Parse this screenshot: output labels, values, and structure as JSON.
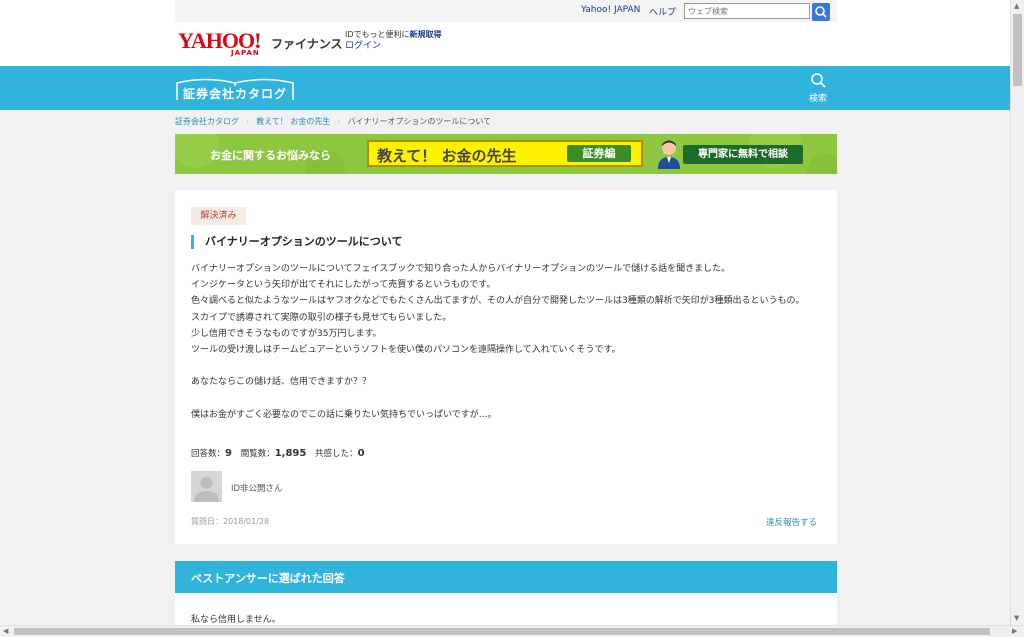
{
  "header": {
    "yahoo_japan_link": "Yahoo! JAPAN",
    "help_link": "ヘルプ",
    "search_placeholder": "ウェブ検索",
    "logo_text": "YAHOO!",
    "logo_sub": "JAPAN",
    "logo_service": "ファイナンス",
    "promo_text": "IDでもっと便利に",
    "promo_link": "新規取得",
    "login_link": "ログイン"
  },
  "nav": {
    "catalog_title": "証券会社カタログ",
    "search_label": "検索"
  },
  "breadcrumb": [
    "証券会社カタログ",
    "教えて！ お金の先生",
    "バイナリーオプションのツールについて"
  ],
  "banner": {
    "left_text": "お金に関するお悩みなら",
    "title": "教えて！ お金の先生",
    "tag": "証券編",
    "cta": "専門家に無料で相談"
  },
  "question": {
    "status": "解決済み",
    "title": "バイナリーオプションのツールについて",
    "body": [
      "バイナリーオプションのツールについてフェイスブックで知り合った人からバイナリーオプションのツールで儲ける話を聞きました。",
      "インジケータという矢印が出てそれにしたがって売買するというものです。",
      "色々調べると似たようなツールはヤフオクなどでもたくさん出てますが、その人が自分で開発したツールは3種類の解析で矢印が3種類出るというもの。",
      "スカイプで誘導されて実際の取引の様子も見せてもらいました。",
      "少し信用できそうなものですが35万円します。",
      "ツールの受け渡しはチームビュアーというソフトを使い僕のパソコンを遠隔操作して入れていくそうです。",
      "",
      "あなたならこの儲け話、信用できますか？？",
      "",
      "僕はお金がすごく必要なのでこの話に乗りたい気持ちでいっぱいですが…。"
    ],
    "answers_label": "回答数：",
    "answers_count": "9",
    "views_label": "閲覧数：",
    "views_count": "1,895",
    "empathy_label": "共感した：",
    "empathy_count": "0",
    "user": "ID非公開さん",
    "date": "質問日：2018/01/28",
    "report_link": "違反報告する"
  },
  "best_answer": {
    "header": "ベストアンサーに選ばれた回答",
    "text": "私なら信用しません。"
  },
  "colors": {
    "brand_blue": "#30b4dc",
    "yahoo_red": "#e60013",
    "banner_green": "#8dc63f"
  }
}
